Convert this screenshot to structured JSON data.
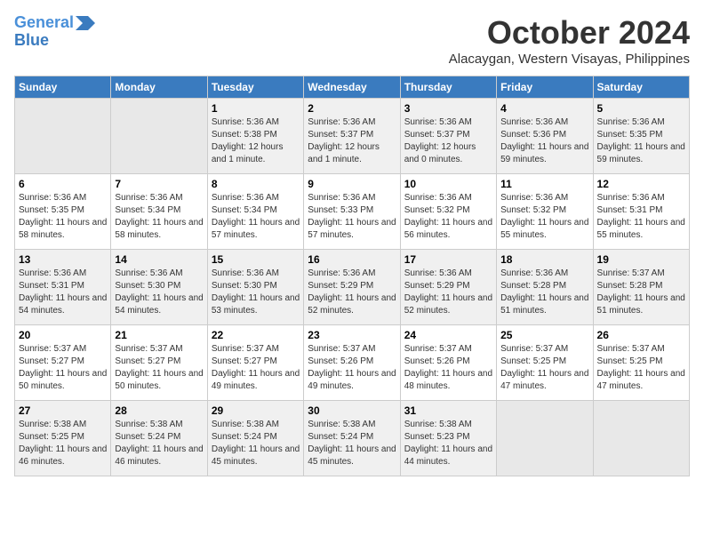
{
  "header": {
    "logo_line1": "General",
    "logo_line2": "Blue",
    "month": "October 2024",
    "location": "Alacaygan, Western Visayas, Philippines"
  },
  "days_of_week": [
    "Sunday",
    "Monday",
    "Tuesday",
    "Wednesday",
    "Thursday",
    "Friday",
    "Saturday"
  ],
  "weeks": [
    [
      {
        "day": "",
        "sunrise": "",
        "sunset": "",
        "daylight": ""
      },
      {
        "day": "",
        "sunrise": "",
        "sunset": "",
        "daylight": ""
      },
      {
        "day": "1",
        "sunrise": "Sunrise: 5:36 AM",
        "sunset": "Sunset: 5:38 PM",
        "daylight": "Daylight: 12 hours and 1 minute."
      },
      {
        "day": "2",
        "sunrise": "Sunrise: 5:36 AM",
        "sunset": "Sunset: 5:37 PM",
        "daylight": "Daylight: 12 hours and 1 minute."
      },
      {
        "day": "3",
        "sunrise": "Sunrise: 5:36 AM",
        "sunset": "Sunset: 5:37 PM",
        "daylight": "Daylight: 12 hours and 0 minutes."
      },
      {
        "day": "4",
        "sunrise": "Sunrise: 5:36 AM",
        "sunset": "Sunset: 5:36 PM",
        "daylight": "Daylight: 11 hours and 59 minutes."
      },
      {
        "day": "5",
        "sunrise": "Sunrise: 5:36 AM",
        "sunset": "Sunset: 5:35 PM",
        "daylight": "Daylight: 11 hours and 59 minutes."
      }
    ],
    [
      {
        "day": "6",
        "sunrise": "Sunrise: 5:36 AM",
        "sunset": "Sunset: 5:35 PM",
        "daylight": "Daylight: 11 hours and 58 minutes."
      },
      {
        "day": "7",
        "sunrise": "Sunrise: 5:36 AM",
        "sunset": "Sunset: 5:34 PM",
        "daylight": "Daylight: 11 hours and 58 minutes."
      },
      {
        "day": "8",
        "sunrise": "Sunrise: 5:36 AM",
        "sunset": "Sunset: 5:34 PM",
        "daylight": "Daylight: 11 hours and 57 minutes."
      },
      {
        "day": "9",
        "sunrise": "Sunrise: 5:36 AM",
        "sunset": "Sunset: 5:33 PM",
        "daylight": "Daylight: 11 hours and 57 minutes."
      },
      {
        "day": "10",
        "sunrise": "Sunrise: 5:36 AM",
        "sunset": "Sunset: 5:32 PM",
        "daylight": "Daylight: 11 hours and 56 minutes."
      },
      {
        "day": "11",
        "sunrise": "Sunrise: 5:36 AM",
        "sunset": "Sunset: 5:32 PM",
        "daylight": "Daylight: 11 hours and 55 minutes."
      },
      {
        "day": "12",
        "sunrise": "Sunrise: 5:36 AM",
        "sunset": "Sunset: 5:31 PM",
        "daylight": "Daylight: 11 hours and 55 minutes."
      }
    ],
    [
      {
        "day": "13",
        "sunrise": "Sunrise: 5:36 AM",
        "sunset": "Sunset: 5:31 PM",
        "daylight": "Daylight: 11 hours and 54 minutes."
      },
      {
        "day": "14",
        "sunrise": "Sunrise: 5:36 AM",
        "sunset": "Sunset: 5:30 PM",
        "daylight": "Daylight: 11 hours and 54 minutes."
      },
      {
        "day": "15",
        "sunrise": "Sunrise: 5:36 AM",
        "sunset": "Sunset: 5:30 PM",
        "daylight": "Daylight: 11 hours and 53 minutes."
      },
      {
        "day": "16",
        "sunrise": "Sunrise: 5:36 AM",
        "sunset": "Sunset: 5:29 PM",
        "daylight": "Daylight: 11 hours and 52 minutes."
      },
      {
        "day": "17",
        "sunrise": "Sunrise: 5:36 AM",
        "sunset": "Sunset: 5:29 PM",
        "daylight": "Daylight: 11 hours and 52 minutes."
      },
      {
        "day": "18",
        "sunrise": "Sunrise: 5:36 AM",
        "sunset": "Sunset: 5:28 PM",
        "daylight": "Daylight: 11 hours and 51 minutes."
      },
      {
        "day": "19",
        "sunrise": "Sunrise: 5:37 AM",
        "sunset": "Sunset: 5:28 PM",
        "daylight": "Daylight: 11 hours and 51 minutes."
      }
    ],
    [
      {
        "day": "20",
        "sunrise": "Sunrise: 5:37 AM",
        "sunset": "Sunset: 5:27 PM",
        "daylight": "Daylight: 11 hours and 50 minutes."
      },
      {
        "day": "21",
        "sunrise": "Sunrise: 5:37 AM",
        "sunset": "Sunset: 5:27 PM",
        "daylight": "Daylight: 11 hours and 50 minutes."
      },
      {
        "day": "22",
        "sunrise": "Sunrise: 5:37 AM",
        "sunset": "Sunset: 5:27 PM",
        "daylight": "Daylight: 11 hours and 49 minutes."
      },
      {
        "day": "23",
        "sunrise": "Sunrise: 5:37 AM",
        "sunset": "Sunset: 5:26 PM",
        "daylight": "Daylight: 11 hours and 49 minutes."
      },
      {
        "day": "24",
        "sunrise": "Sunrise: 5:37 AM",
        "sunset": "Sunset: 5:26 PM",
        "daylight": "Daylight: 11 hours and 48 minutes."
      },
      {
        "day": "25",
        "sunrise": "Sunrise: 5:37 AM",
        "sunset": "Sunset: 5:25 PM",
        "daylight": "Daylight: 11 hours and 47 minutes."
      },
      {
        "day": "26",
        "sunrise": "Sunrise: 5:37 AM",
        "sunset": "Sunset: 5:25 PM",
        "daylight": "Daylight: 11 hours and 47 minutes."
      }
    ],
    [
      {
        "day": "27",
        "sunrise": "Sunrise: 5:38 AM",
        "sunset": "Sunset: 5:25 PM",
        "daylight": "Daylight: 11 hours and 46 minutes."
      },
      {
        "day": "28",
        "sunrise": "Sunrise: 5:38 AM",
        "sunset": "Sunset: 5:24 PM",
        "daylight": "Daylight: 11 hours and 46 minutes."
      },
      {
        "day": "29",
        "sunrise": "Sunrise: 5:38 AM",
        "sunset": "Sunset: 5:24 PM",
        "daylight": "Daylight: 11 hours and 45 minutes."
      },
      {
        "day": "30",
        "sunrise": "Sunrise: 5:38 AM",
        "sunset": "Sunset: 5:24 PM",
        "daylight": "Daylight: 11 hours and 45 minutes."
      },
      {
        "day": "31",
        "sunrise": "Sunrise: 5:38 AM",
        "sunset": "Sunset: 5:23 PM",
        "daylight": "Daylight: 11 hours and 44 minutes."
      },
      {
        "day": "",
        "sunrise": "",
        "sunset": "",
        "daylight": ""
      },
      {
        "day": "",
        "sunrise": "",
        "sunset": "",
        "daylight": ""
      }
    ]
  ]
}
